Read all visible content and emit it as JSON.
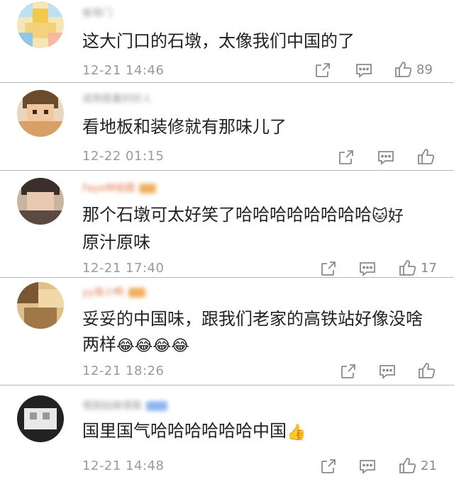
{
  "comments": [
    {
      "username": "偷哥门",
      "text": "这大门口的石墩，太像我们中国的了",
      "emoji": "",
      "date": "12-21 14:46",
      "likes": "89",
      "avatar_colors": [
        "#f2d27a",
        "#8fc7e6"
      ]
    },
    {
      "username": "成熟稳重的好人",
      "text": "看地板和装修就有那味儿了",
      "emoji": "",
      "date": "12-22 01:15",
      "likes": "",
      "avatar_colors": [
        "#d9a066",
        "#6b4a2e"
      ]
    },
    {
      "username": "Faye林桂圆",
      "text": "那个石墩可太好笑了哈哈哈哈哈哈哈哈",
      "text2": "原汁原味",
      "emoji": "🐱好",
      "date": "12-21 17:40",
      "likes": "17",
      "avatar_colors": [
        "#5a4a42",
        "#c9b4a2"
      ]
    },
    {
      "username": "yy吴小鸭",
      "text": "妥妥的中国味，跟我们老家的高铁站好像没啥",
      "text2": "两样",
      "emoji": "😂😂😂😂",
      "date": "12-21 18:26",
      "likes": "",
      "avatar_colors": [
        "#7a5632",
        "#e0c08a"
      ]
    },
    {
      "username": "借困姑娘借贩",
      "text": "国里国气哈哈哈哈哈哈中国",
      "emoji": "👍",
      "date": "12-21 14:48",
      "likes": "21",
      "avatar_colors": [
        "#222222",
        "#e8e8e8"
      ]
    }
  ]
}
